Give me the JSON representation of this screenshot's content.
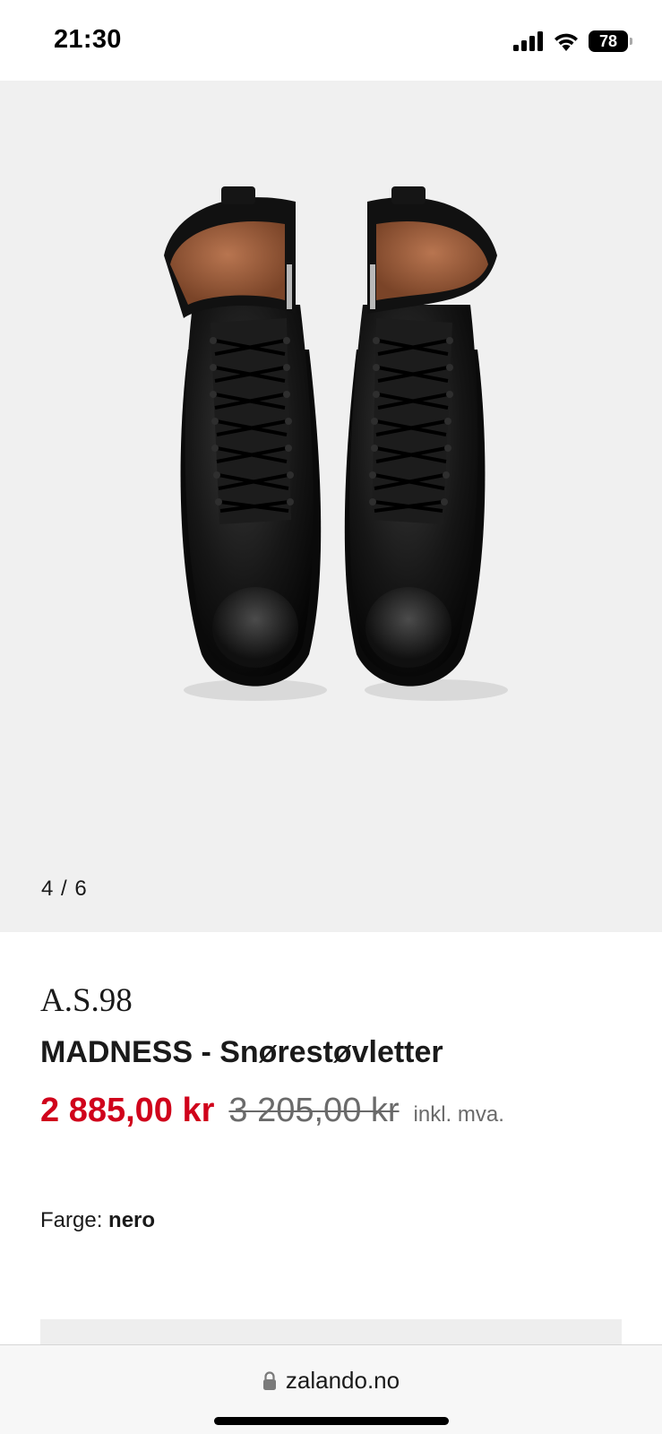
{
  "status_bar": {
    "time": "21:30",
    "battery": "78",
    "icons": [
      "signal-icon",
      "wifi-icon",
      "battery-icon"
    ]
  },
  "gallery": {
    "counter": "4 / 6",
    "image_subject": "boots-photo"
  },
  "product": {
    "brand": "A.S.98",
    "name": "MADNESS - Snørestøvletter",
    "price_current": "2 885,00 kr",
    "price_original": "3 205,00 kr",
    "tax_note": "inkl. mva.",
    "color_label": "Farge:",
    "color_value": "nero"
  },
  "browser": {
    "url": "zalando.no",
    "icon": "lock-icon"
  },
  "colors": {
    "sale_red": "#d0021b",
    "muted_gray": "#6a6a6a",
    "gallery_bg": "#f0f0f0"
  }
}
